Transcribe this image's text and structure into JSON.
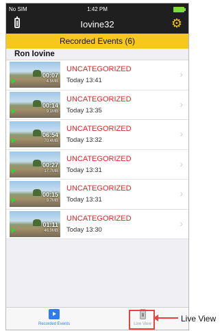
{
  "status_bar": {
    "carrier": "No SIM",
    "time": "1:42 PM"
  },
  "nav": {
    "title": "Iovine32",
    "left_icon": "battery-icon",
    "right_icon": "gear-icon",
    "accent": "#f2c313"
  },
  "banner": {
    "label": "Recorded Events (6)",
    "color": "#f6c81e"
  },
  "section": {
    "title": "Ron Iovine"
  },
  "events": [
    {
      "duration": "00:07",
      "size": "4.5MB",
      "category": "UNCATEGORIZED",
      "when": "Today 13:41"
    },
    {
      "duration": "00:14",
      "size": "9.1MB",
      "category": "UNCATEGORIZED",
      "when": "Today 13:35"
    },
    {
      "duration": "06:54",
      "size": "70.4MB",
      "category": "UNCATEGORIZED",
      "when": "Today 13:32"
    },
    {
      "duration": "00:27",
      "size": "17.7MB",
      "category": "UNCATEGORIZED",
      "when": "Today 13:31"
    },
    {
      "duration": "00:15",
      "size": "9.7MB",
      "category": "UNCATEGORIZED",
      "when": "Today 13:31"
    },
    {
      "duration": "01:11",
      "size": "46.0MB",
      "category": "UNCATEGORIZED",
      "when": "Today 13:30"
    }
  ],
  "tabbar": {
    "events_label": "Recorded Events",
    "live_label": "Live View",
    "active_color": "#2d7cf6"
  },
  "annotation": {
    "callout": "Live View",
    "color": "#e8413f"
  }
}
